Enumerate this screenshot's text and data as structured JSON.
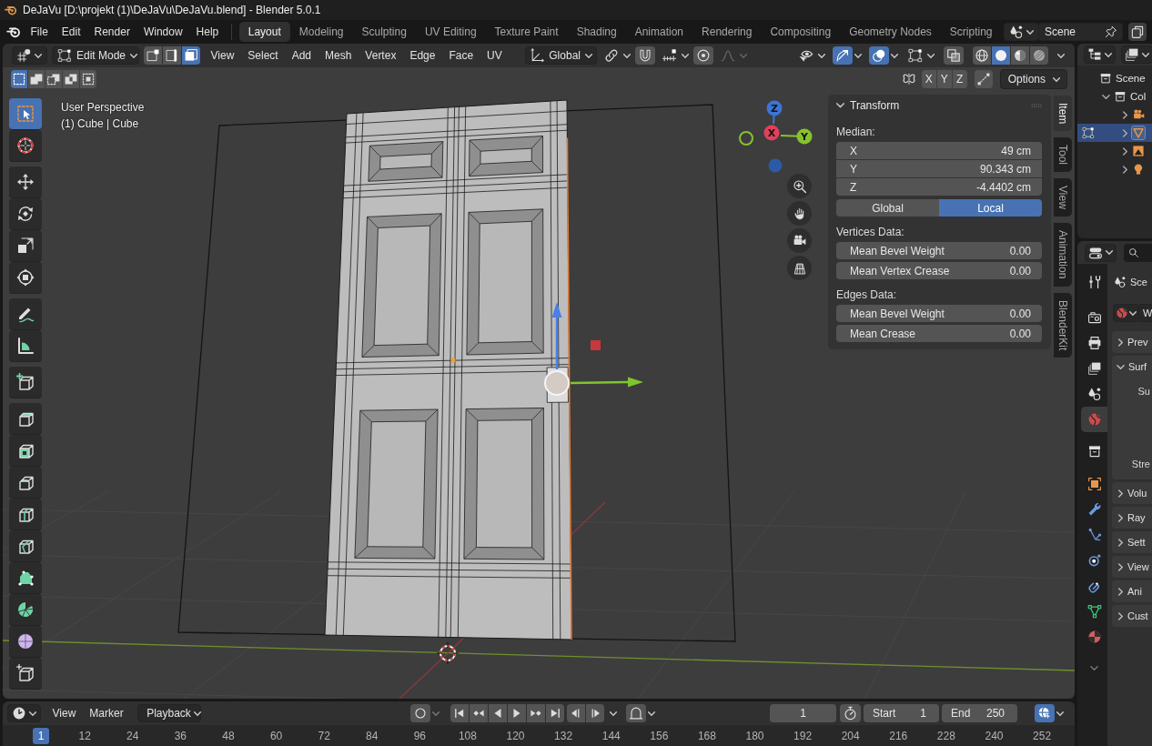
{
  "title_bar": {
    "title": "DeJaVu [D:\\projekt (1)\\DeJaVu\\DeJaVu.blend] - Blender 5.0.1"
  },
  "menu_bar": {
    "menus": [
      "File",
      "Edit",
      "Render",
      "Window",
      "Help"
    ],
    "workspaces": [
      {
        "label": "Layout",
        "selected": true
      },
      {
        "label": "Modeling",
        "selected": false
      },
      {
        "label": "Sculpting",
        "selected": false
      },
      {
        "label": "UV Editing",
        "selected": false
      },
      {
        "label": "Texture Paint",
        "selected": false
      },
      {
        "label": "Shading",
        "selected": false
      },
      {
        "label": "Animation",
        "selected": false
      },
      {
        "label": "Rendering",
        "selected": false
      },
      {
        "label": "Compositing",
        "selected": false
      },
      {
        "label": "Geometry Nodes",
        "selected": false
      },
      {
        "label": "Scripting",
        "selected": false
      }
    ],
    "scene": {
      "value": "Scene"
    }
  },
  "viewport_header": {
    "mode": "Edit Mode",
    "select_modes": [
      {
        "kind": "vertex",
        "selected": false
      },
      {
        "kind": "edge",
        "selected": false
      },
      {
        "kind": "face",
        "selected": true
      }
    ],
    "menus": [
      "View",
      "Select",
      "Add",
      "Mesh",
      "Vertex",
      "Edge",
      "Face",
      "UV"
    ],
    "orientation": "Global",
    "snapping": [
      {
        "kind": "pivot",
        "on": false,
        "disabled": false
      },
      {
        "kind": "snap",
        "on": false,
        "disabled": false
      },
      {
        "kind": "snap_target",
        "on": false,
        "disabled": false
      },
      {
        "kind": "proportional",
        "on": false,
        "disabled": false
      },
      {
        "kind": "falloff",
        "on": false,
        "disabled": true
      }
    ],
    "display": [
      {
        "kind": "visibility",
        "on": false
      },
      {
        "kind": "gizmo",
        "on": true
      },
      {
        "kind": "overlay",
        "on": true
      },
      {
        "kind": "mesh_overlay",
        "on": false
      },
      {
        "kind": "xray",
        "on": false
      }
    ],
    "shading": [
      {
        "kind": "wireframe",
        "selected": false
      },
      {
        "kind": "solid",
        "selected": true
      },
      {
        "kind": "material",
        "selected": false
      },
      {
        "kind": "rendered",
        "selected": false
      }
    ]
  },
  "tool_settings": {
    "select_ops": [
      {
        "kind": "set",
        "selected": true
      },
      {
        "kind": "extend",
        "selected": false
      },
      {
        "kind": "subtract",
        "selected": false
      },
      {
        "kind": "invert",
        "selected": false
      },
      {
        "kind": "intersect",
        "selected": false
      }
    ],
    "mirror": [
      {
        "label": "X",
        "on": false
      },
      {
        "label": "Y",
        "on": false
      },
      {
        "label": "Z",
        "on": false
      }
    ],
    "options": "Options"
  },
  "toolbar": {
    "tools": [
      {
        "kind": "select_box",
        "selected": true
      },
      {
        "kind": "cursor",
        "selected": false
      },
      {
        "kind": "move",
        "selected": false
      },
      {
        "kind": "rotate",
        "selected": false
      },
      {
        "kind": "scale",
        "selected": false
      },
      {
        "kind": "transform",
        "selected": false
      },
      {
        "kind": "annotate",
        "selected": false
      },
      {
        "kind": "measure",
        "selected": false
      },
      {
        "kind": "add_cube",
        "selected": false
      },
      {
        "kind": "extrude",
        "selected": false
      },
      {
        "kind": "inset",
        "selected": false
      },
      {
        "kind": "bevel",
        "selected": false
      },
      {
        "kind": "loop_cut",
        "selected": false
      },
      {
        "kind": "knife",
        "selected": false
      },
      {
        "kind": "poly_build",
        "selected": false
      },
      {
        "kind": "spin",
        "selected": false
      },
      {
        "kind": "smooth",
        "selected": false
      },
      {
        "kind": "rip",
        "selected": false
      }
    ]
  },
  "viewport": {
    "view_name": "User Perspective",
    "object_info": "(1) Cube | Cube",
    "nav_axes": [
      {
        "kind": "z",
        "label": "Z"
      },
      {
        "kind": "x",
        "label": "X"
      },
      {
        "kind": "y",
        "label": "Y"
      }
    ]
  },
  "sidebar": {
    "tabs": [
      {
        "label": "Item",
        "selected": true
      },
      {
        "label": "Tool",
        "selected": false
      },
      {
        "label": "View",
        "selected": false
      },
      {
        "label": "Animation",
        "selected": false
      },
      {
        "label": "BlenderKit",
        "selected": false
      }
    ],
    "panel": {
      "title": "Transform",
      "expanded": true,
      "median_label": "Median:",
      "median": [
        {
          "label": "X",
          "value": "49 cm"
        },
        {
          "label": "Y",
          "value": "90.343 cm"
        },
        {
          "label": "Z",
          "value": "-4.4402 cm"
        }
      ],
      "space": [
        {
          "label": "Global",
          "selected": false
        },
        {
          "label": "Local",
          "selected": true
        }
      ],
      "sections": [
        {
          "title": "Vertices Data:",
          "fields": [
            {
              "label": "Mean Bevel Weight",
              "value": "0.00"
            },
            {
              "label": "Mean Vertex Crease",
              "value": "0.00"
            }
          ]
        },
        {
          "title": "Edges Data:",
          "fields": [
            {
              "label": "Mean Bevel Weight",
              "value": "0.00"
            },
            {
              "label": "Mean Crease",
              "value": "0.00"
            }
          ]
        }
      ]
    }
  },
  "outliner": {
    "tree": [
      {
        "label": "Scene",
        "kind": "scene_collection",
        "selected": false,
        "children": [
          {
            "label": "Col",
            "kind": "collection",
            "expanded": true,
            "selected": false,
            "children": [
              {
                "kind": "camera",
                "expanded": false,
                "selected": false
              },
              {
                "kind": "mesh",
                "expanded": false,
                "selected": true
              },
              {
                "kind": "image",
                "expanded": false,
                "selected": false
              },
              {
                "kind": "light",
                "expanded": false,
                "selected": false
              }
            ]
          }
        ]
      }
    ]
  },
  "properties": {
    "tabs": [
      {
        "kind": "tool",
        "selected": false
      },
      {
        "kind": "render",
        "selected": false
      },
      {
        "kind": "output",
        "selected": false
      },
      {
        "kind": "view_layer",
        "selected": false
      },
      {
        "kind": "scene",
        "selected": false
      },
      {
        "kind": "world",
        "selected": true
      },
      {
        "kind": "collection",
        "selected": false
      },
      {
        "kind": "object",
        "selected": false
      },
      {
        "kind": "modifiers",
        "selected": false
      },
      {
        "kind": "particles",
        "selected": false
      },
      {
        "kind": "physics",
        "selected": false
      },
      {
        "kind": "constraints",
        "selected": false
      },
      {
        "kind": "data",
        "selected": false
      },
      {
        "kind": "material",
        "selected": false
      }
    ],
    "context": "Sce",
    "world": "W",
    "panels": [
      {
        "label": "Prev",
        "expanded": false
      },
      {
        "label": "Surf",
        "expanded": true,
        "rows": [
          "Su",
          "Stre"
        ]
      },
      {
        "label": "Volu",
        "expanded": false
      },
      {
        "label": "Ray",
        "expanded": false
      },
      {
        "label": "Sett",
        "expanded": false
      },
      {
        "label": "View",
        "expanded": false
      },
      {
        "label": "Ani",
        "expanded": false
      },
      {
        "label": "Cust",
        "expanded": false
      }
    ]
  },
  "timeline": {
    "menus": [
      "View",
      "Marker"
    ],
    "playback": "Playback",
    "keying": {
      "on": false
    },
    "snapping": {
      "on": false
    },
    "current_frame": "1",
    "start": {
      "label": "Start",
      "value": "1"
    },
    "end": {
      "label": "End",
      "value": "250"
    },
    "sync": {
      "on": true
    },
    "frames": [
      {
        "label": "1",
        "selected": true
      },
      {
        "label": "12",
        "selected": false
      },
      {
        "label": "24",
        "selected": false
      },
      {
        "label": "36",
        "selected": false
      },
      {
        "label": "48",
        "selected": false
      },
      {
        "label": "60",
        "selected": false
      },
      {
        "label": "72",
        "selected": false
      },
      {
        "label": "84",
        "selected": false
      },
      {
        "label": "96",
        "selected": false
      },
      {
        "label": "108",
        "selected": false
      },
      {
        "label": "120",
        "selected": false
      },
      {
        "label": "132",
        "selected": false
      },
      {
        "label": "144",
        "selected": false
      },
      {
        "label": "156",
        "selected": false
      },
      {
        "label": "168",
        "selected": false
      },
      {
        "label": "180",
        "selected": false
      },
      {
        "label": "192",
        "selected": false
      },
      {
        "label": "204",
        "selected": false
      },
      {
        "label": "216",
        "selected": false
      },
      {
        "label": "228",
        "selected": false
      },
      {
        "label": "240",
        "selected": false
      },
      {
        "label": "252",
        "selected": false
      }
    ]
  }
}
